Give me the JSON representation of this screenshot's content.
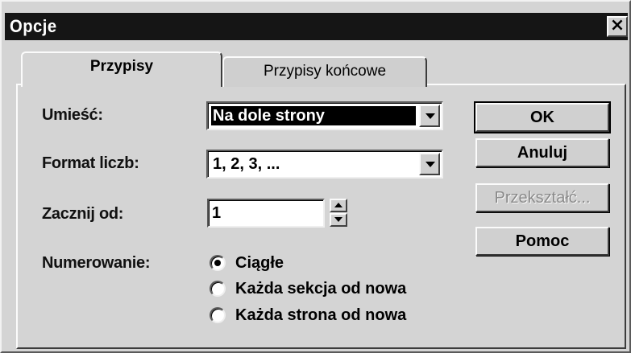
{
  "window": {
    "title": "Opcje",
    "close_glyph": "×"
  },
  "tabs": [
    {
      "label": "Przypisy",
      "active": true
    },
    {
      "label": "Przypisy końcowe",
      "active": false
    }
  ],
  "placement": {
    "label": "Umieść:",
    "value": "Na dole strony"
  },
  "number_format": {
    "label": "Format liczb:",
    "value": "1, 2, 3, ..."
  },
  "start_at": {
    "label": "Zacznij od:",
    "value": "1"
  },
  "numbering": {
    "label": "Numerowanie:",
    "options": [
      {
        "label": "Ciągłe",
        "checked": true
      },
      {
        "label": "Każda sekcja od nowa",
        "checked": false
      },
      {
        "label": "Każda strona od nowa",
        "checked": false
      }
    ]
  },
  "buttons": {
    "ok": "OK",
    "cancel": "Anuluj",
    "convert": "Przekształć...",
    "help": "Pomoc"
  }
}
